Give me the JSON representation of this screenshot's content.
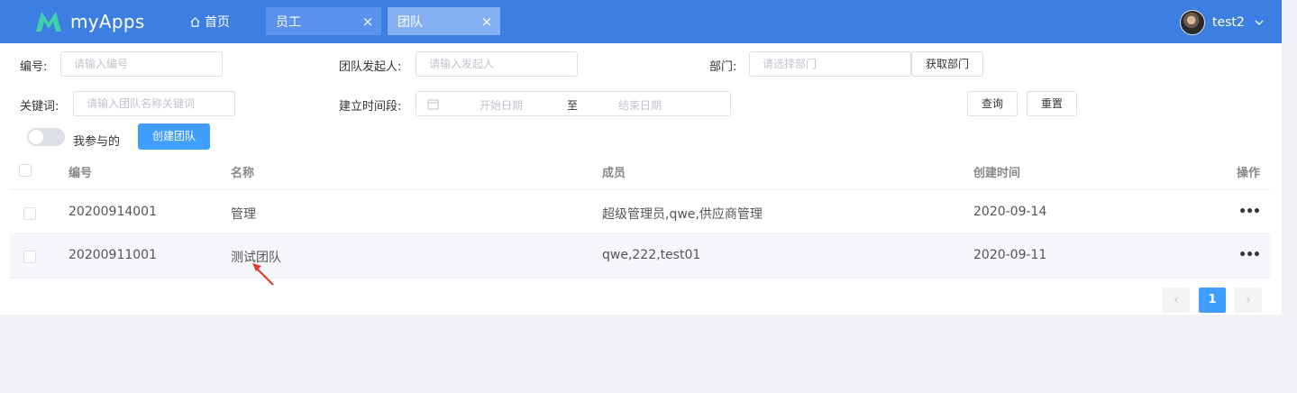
{
  "header": {
    "app_name": "myApps",
    "home_label": "首页",
    "tabs": [
      {
        "label": "员工",
        "close": "×"
      },
      {
        "label": "团队",
        "close": "×"
      }
    ],
    "user_name": "test2",
    "brand_color": "#3d7ee2"
  },
  "filters": {
    "id_label": "编号:",
    "id_placeholder": "请输入编号",
    "initiator_label": "团队发起人:",
    "initiator_placeholder": "请输入发起人",
    "dept_label": "部门:",
    "dept_placeholder": "请选择部门",
    "dept_button": "获取部门",
    "keyword_label": "关键词:",
    "keyword_placeholder": "请输入团队名称关键词",
    "date_label": "建立时间段:",
    "date_start_placeholder": "开始日期",
    "date_separator": "至",
    "date_end_placeholder": "结束日期",
    "query_button": "查询",
    "reset_button": "重置",
    "mine_switch_label": "我参与的",
    "mine_switch_on": false,
    "create_button": "创建团队"
  },
  "table": {
    "columns": [
      "编号",
      "名称",
      "成员",
      "创建时间",
      "操作"
    ],
    "rows": [
      {
        "id": "20200914001",
        "name": "管理",
        "members": "超级管理员,qwe,供应商管理",
        "created": "2020-09-14",
        "action": "•••"
      },
      {
        "id": "20200911001",
        "name": "测试团队",
        "members": "qwe,222,test01",
        "created": "2020-09-11",
        "action": "•••"
      }
    ]
  },
  "pagination": {
    "prev": "‹",
    "current": "1",
    "next": "›"
  }
}
